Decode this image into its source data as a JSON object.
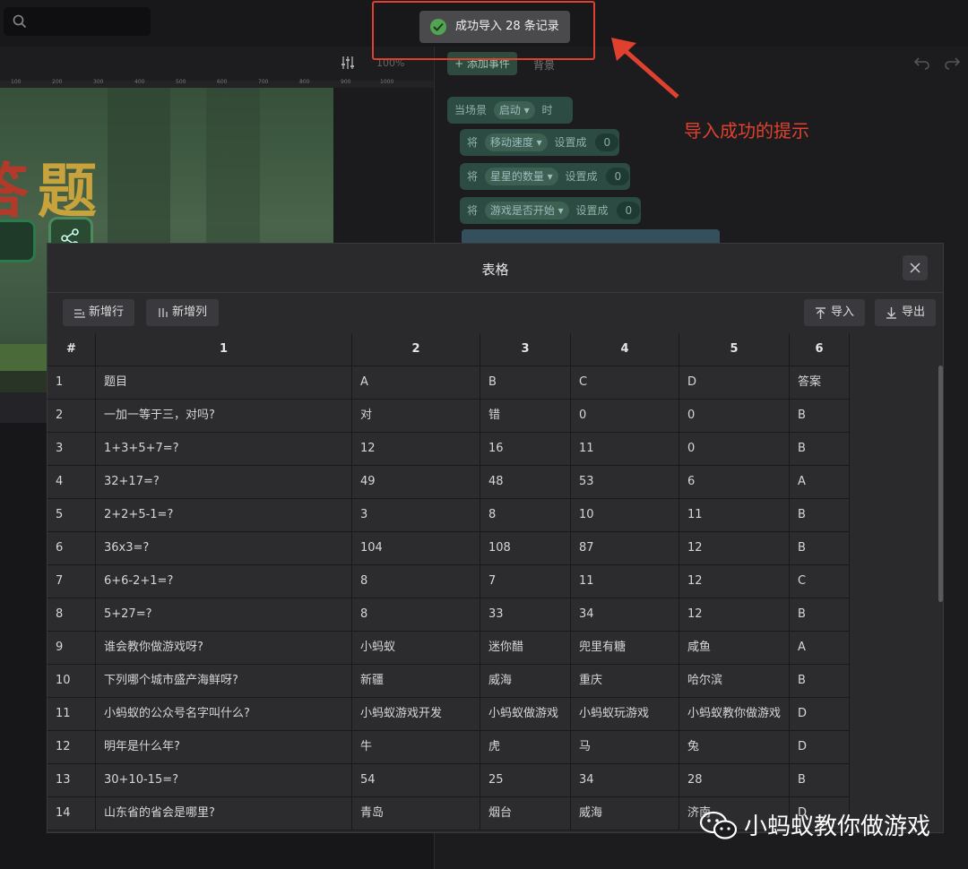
{
  "toast": {
    "message": "成功导入 28 条记录"
  },
  "annotation": {
    "text": "导入成功的提示"
  },
  "left_panel": {
    "zoom": "100%",
    "ruler_ticks": [
      "100",
      "200",
      "300",
      "400",
      "500",
      "600",
      "700",
      "800",
      "900",
      "1000"
    ]
  },
  "game_preview": {
    "title_part1": "答",
    "title_part2": "题"
  },
  "right_panel": {
    "add_event_label": "+ 添加事件",
    "bg_tab_label": "背景",
    "blocks": [
      {
        "prefix": "当场景",
        "pill": "启动 ▾",
        "suffix": "时"
      },
      {
        "prefix": "将",
        "pill": "移动速度 ▾",
        "suffix": "设置成",
        "value": "0"
      },
      {
        "prefix": "将",
        "pill": "星星的数量 ▾",
        "suffix": "设置成",
        "value": "0"
      },
      {
        "prefix": "将",
        "pill": "游戏是否开始 ▾",
        "suffix": "设置成",
        "value": "0"
      }
    ]
  },
  "modal": {
    "title": "表格",
    "add_row_label": "新增行",
    "add_col_label": "新增列",
    "import_label": "导入",
    "export_label": "导出",
    "columns": [
      "#",
      "1",
      "2",
      "3",
      "4",
      "5",
      "6"
    ],
    "rows": [
      [
        "1",
        "题目",
        "A",
        "B",
        "C",
        "D",
        "答案"
      ],
      [
        "2",
        "一加一等于三，对吗?",
        "对",
        "错",
        "0",
        "0",
        "B"
      ],
      [
        "3",
        "1+3+5+7=?",
        "12",
        "16",
        "11",
        "0",
        "B"
      ],
      [
        "4",
        "32+17=?",
        "49",
        "48",
        "53",
        "6",
        "A"
      ],
      [
        "5",
        "2+2+5-1=?",
        "3",
        "8",
        "10",
        "11",
        "B"
      ],
      [
        "6",
        "36x3=?",
        "104",
        "108",
        "87",
        "12",
        "B"
      ],
      [
        "7",
        "6+6-2+1=?",
        "8",
        "7",
        "11",
        "12",
        "C"
      ],
      [
        "8",
        "5+27=?",
        "8",
        "33",
        "34",
        "12",
        "B"
      ],
      [
        "9",
        "谁会教你做游戏呀?",
        "小蚂蚁",
        "迷你醋",
        "兜里有糖",
        "咸鱼",
        "A"
      ],
      [
        "10",
        "下列哪个城市盛产海鲜呀?",
        "新疆",
        "威海",
        "重庆",
        "哈尔滨",
        "B"
      ],
      [
        "11",
        "小蚂蚁的公众号名字叫什么?",
        "小蚂蚁游戏开发",
        "小蚂蚁做游戏",
        "小蚂蚁玩游戏",
        "小蚂蚁教你做游戏",
        "D"
      ],
      [
        "12",
        "明年是什么年?",
        "牛",
        "虎",
        "马",
        "兔",
        "D"
      ],
      [
        "13",
        "30+10-15=?",
        "54",
        "25",
        "34",
        "28",
        "B"
      ],
      [
        "14",
        "山东省的省会是哪里?",
        "青岛",
        "烟台",
        "威海",
        "济南",
        "D"
      ]
    ]
  },
  "watermark": {
    "text": "小蚂蚁教你做游戏"
  }
}
